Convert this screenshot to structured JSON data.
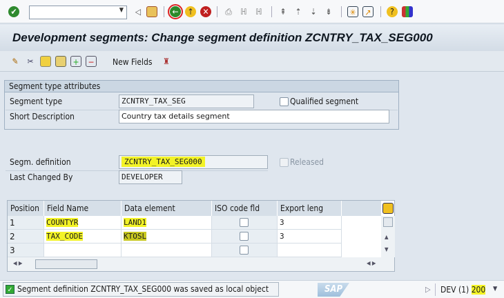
{
  "toolbar": {
    "command_field": "",
    "icons": [
      "enter-icon",
      "back-arrow-icon",
      "save-icon",
      "back-icon",
      "exit-icon",
      "cancel-icon",
      "print-icon",
      "find-icon",
      "find-next-icon",
      "first-page-icon",
      "prev-page-icon",
      "next-page-icon",
      "last-page-icon",
      "new-session-icon",
      "shortcut-icon",
      "help-icon",
      "layout-icon"
    ]
  },
  "title": "Development segments: Change segment definition ZCNTRY_TAX_SEG000",
  "app_toolbar": {
    "new_fields": "New Fields"
  },
  "group": {
    "title": "Segment type attributes",
    "segment_type_label": "Segment type",
    "segment_type": "ZCNTRY_TAX_SEG",
    "qualified_label": "Qualified segment",
    "short_desc_label": "Short Description",
    "short_desc": "Country tax details segment"
  },
  "definition": {
    "label": "Segm. definition",
    "value": "ZCNTRY_TAX_SEG000",
    "released_label": "Released",
    "last_changed_label": "Last Changed By",
    "last_changed": "DEVELOPER"
  },
  "table": {
    "headers": [
      "Position",
      "Field Name",
      "Data element",
      "ISO code fld",
      "Export leng"
    ],
    "rows": [
      {
        "pos": "1",
        "field": "COUNTYR",
        "element": "LAND1",
        "export": "3"
      },
      {
        "pos": "2",
        "field": "TAX_CODE",
        "element": "KTOSL",
        "export": "3"
      },
      {
        "pos": "3",
        "field": "",
        "element": "",
        "export": ""
      }
    ]
  },
  "status": {
    "message": "Segment definition ZCNTRY_TAX_SEG000 was saved as local object",
    "logo": "SAP",
    "system": "DEV (1)",
    "client": "200"
  },
  "colors": {
    "highlight": "#f3f326",
    "title_bg": "#dfe6ee"
  }
}
